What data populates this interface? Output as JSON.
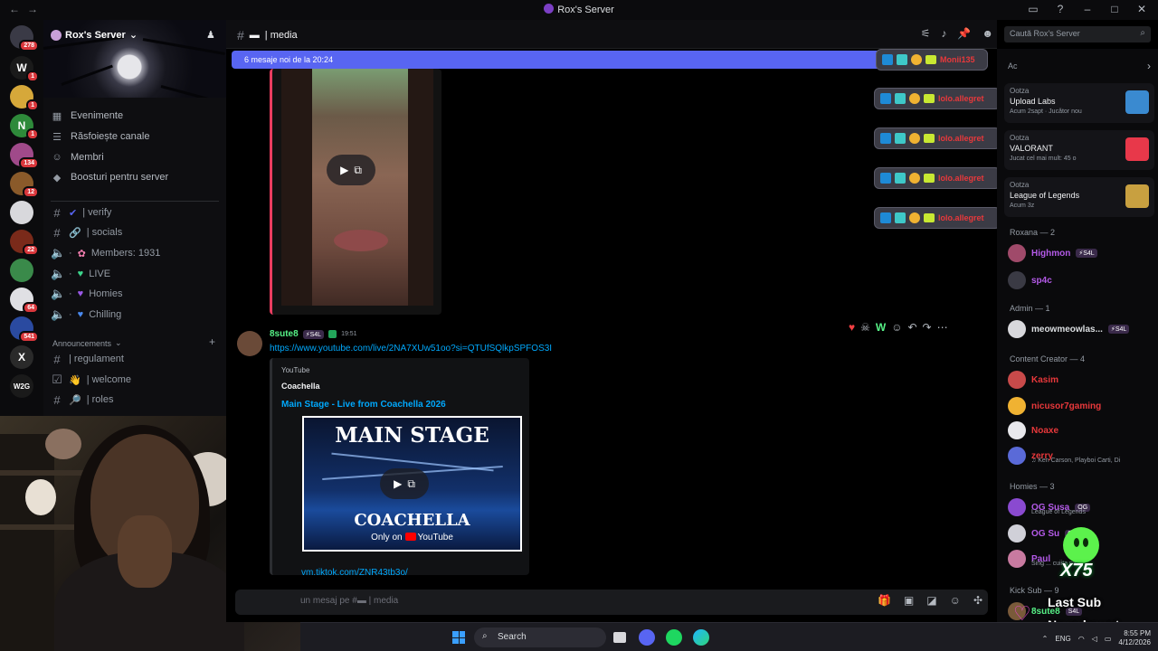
{
  "window": {
    "title": "Rox's Server",
    "nav_back": "←",
    "nav_fwd": "→"
  },
  "rail": {
    "servers": [
      {
        "badge": "278",
        "color": "#3a3a46"
      },
      {
        "badge": "1",
        "color": "#1a1a1a",
        "letter": "W"
      },
      {
        "badge": "1",
        "color": "#d6a83a"
      },
      {
        "badge": "1",
        "color": "#2e8a3a",
        "letter": "N"
      },
      {
        "badge": "134",
        "color": "#a04a8a"
      },
      {
        "badge": "12",
        "color": "#8a5a2a"
      },
      {
        "badge": "",
        "color": "#d8d8dc"
      },
      {
        "badge": "22",
        "color": "#7a2a1a"
      },
      {
        "badge": "",
        "color": "#3a8a4a"
      },
      {
        "badge": "64",
        "color": "#e0e0e4"
      },
      {
        "badge": "541",
        "color": "#2a4aa0"
      },
      {
        "badge": "",
        "color": "#2a2a2a",
        "letter": "X"
      },
      {
        "badge": "",
        "color": "#1a1a1a",
        "letter": "W2G"
      },
      {
        "badge": "",
        "color": "#6a5a4a"
      }
    ]
  },
  "sidebar": {
    "server_name": "Rox's Server",
    "menu": [
      {
        "label": "Evenimente",
        "icon": "calendar-icon",
        "glyph": "▦"
      },
      {
        "label": "Răsfoiește canale",
        "icon": "browse-channels-icon",
        "glyph": "☰"
      },
      {
        "label": "Membri",
        "icon": "members-icon",
        "glyph": "☺"
      },
      {
        "label": "Boosturi pentru server",
        "icon": "boost-icon",
        "glyph": "◆"
      }
    ],
    "channels": [
      {
        "label": "| verify",
        "icon": "#",
        "emoji": "✔",
        "emoji_color": "#5865f2",
        "dot": false
      },
      {
        "label": "| socials",
        "icon": "#",
        "emoji": "🔗",
        "emoji_color": "#dbdee1",
        "dot": false
      },
      {
        "label": "Members: 1931",
        "icon": "🔈",
        "emoji": "✿",
        "emoji_color": "#f47fb0",
        "dot": true
      },
      {
        "label": "LIVE",
        "icon": "🔈",
        "emoji": "♥",
        "emoji_color": "#3dd68c",
        "dot": true
      },
      {
        "label": "Homies",
        "icon": "🔈",
        "emoji": "♥",
        "emoji_color": "#9b59e8",
        "dot": true
      },
      {
        "label": "Chilling",
        "icon": "🔈",
        "emoji": "♥",
        "emoji_color": "#4a8af0",
        "dot": true
      }
    ],
    "category": "Announcements",
    "channels2": [
      {
        "label": "| regulament",
        "icon": "#",
        "emoji": ""
      },
      {
        "label": "| welcome",
        "icon": "☑",
        "emoji": "👋"
      },
      {
        "label": "| roles",
        "icon": "#",
        "emoji": "🔎"
      }
    ]
  },
  "chat": {
    "channel_name": "| media",
    "search_placeholder": "Caută Rox's Server",
    "new_messages_bar": "6 mesaje noi de la 20:24",
    "message": {
      "author": "8sute8",
      "tag": "⚡S4L",
      "time": "19:51",
      "link": "https://www.youtube.com/live/2NA7XUw51oo?si=QTUfSQlkpSPFOS3I",
      "embed": {
        "provider": "YouTube",
        "author": "Coachella",
        "title": "Main Stage - Live from Coachella 2026",
        "thumb_top": "MAIN STAGE",
        "thumb_brand": "COACHELLA",
        "thumb_only_on": "Only on",
        "thumb_yt": "YouTube"
      }
    },
    "tiktok_link": "vm.tiktok.com/ZNR43tb3o/",
    "composer_placeholder": "un mesaj pe #",
    "composer_channel": "| media"
  },
  "notifications": [
    {
      "user": "Monii135"
    },
    {
      "user": "lolo.allegret"
    },
    {
      "user": "lolo.allegret"
    },
    {
      "user": "lolo.allegret"
    },
    {
      "user": "lolo.allegret"
    }
  ],
  "members": {
    "activity_cards": [
      {
        "who": "Ootza",
        "game": "Upload Labs",
        "sub": "Acum 2sapt · Jucător nou",
        "art_color": "#3a8ad0"
      },
      {
        "who": "Ootza",
        "game": "VALORANT",
        "sub": "Jucat cel mai mult: 45 o",
        "art_color": "#e8384a"
      },
      {
        "who": "Ootza",
        "game": "League of Legends",
        "sub": "Acum 3z",
        "art_color": "#c8a040"
      }
    ],
    "groups": [
      {
        "label": "Roxana — 2",
        "members": [
          {
            "name": "Highmon",
            "color": "#b45ae8",
            "tag": "⚡S4L",
            "status": ""
          },
          {
            "name": "sp4c",
            "color": "#b45ae8",
            "tag": "",
            "status": ""
          }
        ]
      },
      {
        "label": "Admin — 1",
        "members": [
          {
            "name": "meowmeowlas...",
            "color": "#dbdee1",
            "tag": "⚡S4L",
            "status": ""
          }
        ]
      },
      {
        "label": "Content Creator — 4",
        "members": [
          {
            "name": "Kasim",
            "color": "#e8383b",
            "tag": "",
            "status": ""
          },
          {
            "name": "nicusor7gaming",
            "color": "#e8383b",
            "tag": "",
            "status": ""
          },
          {
            "name": "Noaxe",
            "color": "#e8383b",
            "tag": "",
            "status": ""
          },
          {
            "name": "zerry",
            "color": "#e8383b",
            "tag": "",
            "status": "♫ Ken Carson, Playboi Carti, Di"
          }
        ]
      },
      {
        "label": "Homies — 3",
        "members": [
          {
            "name": "OG Susa",
            "color": "#b45ae8",
            "tag": "OG",
            "status": "League of Legends"
          },
          {
            "name": "OG Su",
            "color": "#b45ae8",
            "tag": "OG",
            "status": ""
          },
          {
            "name": "Paul",
            "color": "#b45ae8",
            "tag": "",
            "status": "Sing ... cuiita na..."
          }
        ]
      },
      {
        "label": "Kick Sub — 9",
        "members": [
          {
            "name": "8sute8",
            "color": "#57f287",
            "tag": "S4L",
            "status": ""
          }
        ]
      }
    ]
  },
  "overlay": {
    "multiplier": "X75",
    "last_sub": "Last Sub",
    "no_subs": "No subs yet"
  },
  "taskbar": {
    "search": "Search",
    "lang": "ENG",
    "time": "8:55 PM",
    "date": "4/12/2026"
  }
}
